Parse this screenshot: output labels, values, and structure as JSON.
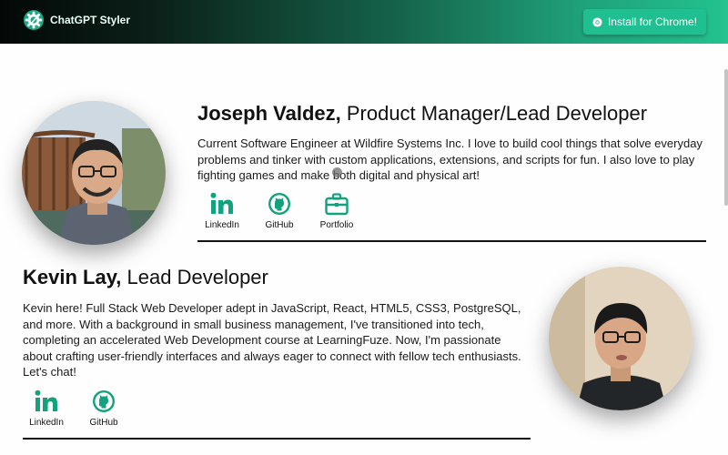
{
  "header": {
    "brand_name": "ChatGPT Styler",
    "install_label": "Install for Chrome!",
    "logo_icon": "gear-logo-icon",
    "button_icon": "chrome-icon"
  },
  "colors": {
    "accent": "#1fbf91",
    "icon_green": "#12a27d",
    "text": "#111111"
  },
  "profiles": [
    {
      "name": "Joseph Valdez,",
      "role": " Product Manager/Lead Developer",
      "bio": "Current Software Engineer at Wildfire Systems Inc. I love to build cool things that solve everyday problems and tinker with custom applications, extensions, and scripts for fun. I also love to play fighting games and make both digital and physical art!",
      "links": [
        {
          "label": "LinkedIn",
          "icon": "linkedin-icon"
        },
        {
          "label": "GitHub",
          "icon": "github-icon"
        },
        {
          "label": "Portfolio",
          "icon": "briefcase-icon"
        }
      ]
    },
    {
      "name": "Kevin Lay,",
      "role": " Lead Developer",
      "bio": "Kevin here! Full Stack Web Developer adept in JavaScript, React, HTML5, CSS3, PostgreSQL, and more. With a background in small business management, I've transitioned into tech, completing an accelerated Web Development course at LearningFuze. Now, I'm passionate about crafting user-friendly interfaces and always eager to connect with fellow tech enthusiasts. Let's chat!",
      "links": [
        {
          "label": "LinkedIn",
          "icon": "linkedin-icon"
        },
        {
          "label": "GitHub",
          "icon": "github-icon"
        }
      ]
    }
  ]
}
